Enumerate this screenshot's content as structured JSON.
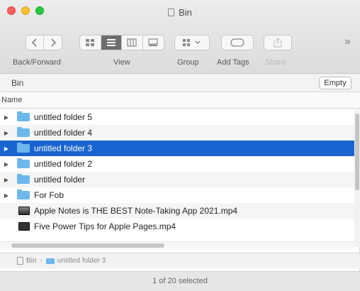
{
  "window": {
    "title": "Bin"
  },
  "toolbar": {
    "back_forward_label": "Back/Forward",
    "view_label": "View",
    "group_label": "Group",
    "add_tags_label": "Add Tags",
    "share_label": "Share",
    "more": "»"
  },
  "pathbar": {
    "label": "Bin",
    "empty_button": "Empty"
  },
  "columns": {
    "name": "Name"
  },
  "items": [
    {
      "label": "untitled folder 5",
      "type": "folder",
      "expandable": true
    },
    {
      "label": "untitled folder 4",
      "type": "folder",
      "expandable": true
    },
    {
      "label": "untitled folder 3",
      "type": "folder",
      "expandable": true,
      "selected": true
    },
    {
      "label": "untitled folder 2",
      "type": "folder",
      "expandable": true
    },
    {
      "label": "untitled folder",
      "type": "folder",
      "expandable": true
    },
    {
      "label": "For Fob",
      "type": "folder",
      "expandable": true
    },
    {
      "label": "Apple Notes is THE BEST Note-Taking App 2021.mp4",
      "type": "video"
    },
    {
      "label": "Five Power Tips for Apple Pages.mp4",
      "type": "video"
    }
  ],
  "breadcrumb": {
    "root": "Bin",
    "current": "untitled folder 3"
  },
  "status": {
    "text": "1 of 20 selected"
  },
  "colors": {
    "selection": "#1964d1",
    "folder": "#6cb8ec"
  }
}
